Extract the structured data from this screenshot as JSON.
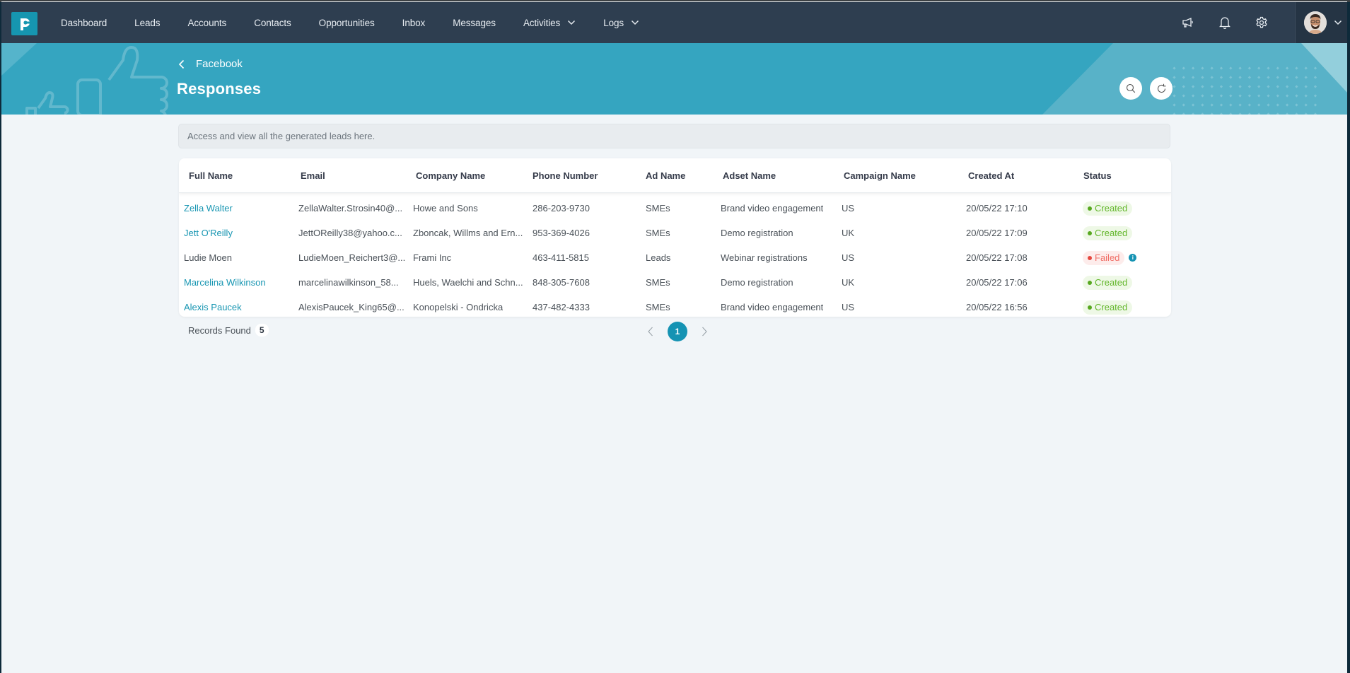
{
  "navbar": {
    "items": [
      {
        "label": "Dashboard",
        "dropdown": false
      },
      {
        "label": "Leads",
        "dropdown": false
      },
      {
        "label": "Accounts",
        "dropdown": false
      },
      {
        "label": "Contacts",
        "dropdown": false
      },
      {
        "label": "Opportunities",
        "dropdown": false
      },
      {
        "label": "Inbox",
        "dropdown": false
      },
      {
        "label": "Messages",
        "dropdown": false
      },
      {
        "label": "Activities",
        "dropdown": true
      },
      {
        "label": "Logs",
        "dropdown": true
      }
    ],
    "icons": [
      "megaphone-icon",
      "bell-icon",
      "gear-icon"
    ]
  },
  "header": {
    "breadcrumb": "Facebook",
    "title": "Responses"
  },
  "info_text": "Access and view all the generated leads here.",
  "table": {
    "columns": [
      "Full Name",
      "Email",
      "Company Name",
      "Phone Number",
      "Ad Name",
      "Adset Name",
      "Campaign Name",
      "Created At",
      "Status"
    ],
    "rows": [
      {
        "full_name": "Zella Walter",
        "linked": true,
        "email": "ZellaWalter.Strosin40@...",
        "company": "Howe and Sons",
        "phone": "286-203-9730",
        "ad_name": "SMEs",
        "adset_name": "Brand video engagement",
        "campaign": "US",
        "created_at": "20/05/22 17:10",
        "status": "Created"
      },
      {
        "full_name": "Jett O'Reilly",
        "linked": true,
        "email": "JettOReilly38@yahoo.c...",
        "company": "Zboncak, Willms and Ern...",
        "phone": "953-369-4026",
        "ad_name": "SMEs",
        "adset_name": "Demo registration",
        "campaign": "UK",
        "created_at": "20/05/22 17:09",
        "status": "Created"
      },
      {
        "full_name": "Ludie Moen",
        "linked": false,
        "email": "LudieMoen_Reichert3@...",
        "company": "Frami Inc",
        "phone": "463-411-5815",
        "ad_name": "Leads",
        "adset_name": "Webinar registrations",
        "campaign": "US",
        "created_at": "20/05/22 17:08",
        "status": "Failed"
      },
      {
        "full_name": "Marcelina Wilkinson",
        "linked": true,
        "email": "marcelinawilkinson_58...",
        "company": "Huels, Waelchi and Schn...",
        "phone": "848-305-7608",
        "ad_name": "SMEs",
        "adset_name": "Demo registration",
        "campaign": "UK",
        "created_at": "20/05/22 17:06",
        "status": "Created"
      },
      {
        "full_name": "Alexis Paucek",
        "linked": true,
        "email": "AlexisPaucek_King65@...",
        "company": "Konopelski - Ondricka",
        "phone": "437-482-4333",
        "ad_name": "SMEs",
        "adset_name": "Brand video engagement",
        "campaign": "US",
        "created_at": "20/05/22 16:56",
        "status": "Created"
      }
    ]
  },
  "footer": {
    "records_label": "Records Found",
    "records_count": "5",
    "current_page": "1"
  },
  "colors": {
    "navbar": "#2e3e50",
    "banner": "#35a5c0",
    "accent": "#1593b3",
    "link": "#1896b2",
    "created": "#62b62a",
    "failed": "#f06f67"
  }
}
